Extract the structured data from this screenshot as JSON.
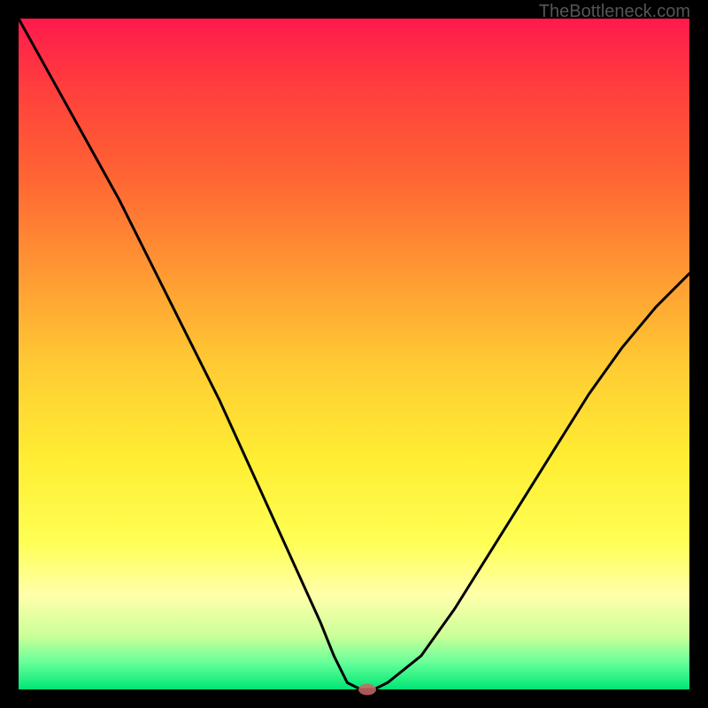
{
  "watermark": "TheBottleneck.com",
  "chart_data": {
    "type": "line",
    "title": "",
    "xlabel": "",
    "ylabel": "",
    "xlim": [
      0,
      100
    ],
    "ylim": [
      0,
      100
    ],
    "x": [
      0,
      5,
      10,
      15,
      20,
      25,
      30,
      35,
      40,
      45,
      47,
      49,
      51,
      53,
      55,
      60,
      65,
      70,
      75,
      80,
      85,
      90,
      95,
      100
    ],
    "values": [
      100,
      91,
      82,
      73,
      63,
      53,
      43,
      32,
      21,
      10,
      5,
      1,
      0,
      0,
      1,
      5,
      12,
      20,
      28,
      36,
      44,
      51,
      57,
      62
    ],
    "marker": {
      "x": 52,
      "y": 0
    },
    "background_gradient": [
      "#ff1a4d",
      "#ff6633",
      "#ffcc33",
      "#ffff55",
      "#00e676"
    ]
  }
}
